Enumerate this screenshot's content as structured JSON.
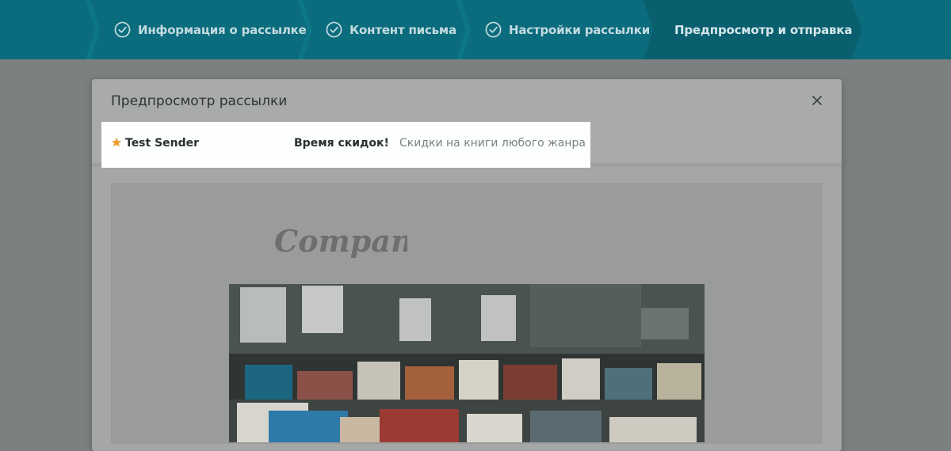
{
  "stepper": {
    "steps": [
      {
        "label": "Информация о рассылке",
        "completed": true
      },
      {
        "label": "Контент письма",
        "completed": true
      },
      {
        "label": "Настройки рассылки",
        "completed": true
      },
      {
        "label": "Предпросмотр и отправка",
        "completed": false,
        "active": true
      }
    ]
  },
  "modal": {
    "title": "Предпросмотр рассылки",
    "close_icon": "close-icon"
  },
  "inbox": {
    "sender": "Test Sender",
    "subject": "Время скидок!",
    "separator": "-",
    "preheader": "Скидки на книги любого жанра",
    "star_icon": "star-icon"
  },
  "email": {
    "logo_text": "Company",
    "hero_image": "books-photo"
  },
  "colors": {
    "stepper_bg": "#0a6c7d",
    "star": "#f0a030",
    "overlay": "#7c8080"
  }
}
